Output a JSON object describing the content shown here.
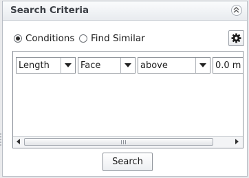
{
  "panel": {
    "title": "Search Criteria",
    "collapse_icon": "double-chevron-up-icon"
  },
  "mode": {
    "options": [
      {
        "label": "Conditions",
        "selected": true
      },
      {
        "label": "Find Similar",
        "selected": false
      }
    ],
    "settings_icon": "gear-icon"
  },
  "criteria": {
    "attribute": "Length",
    "entity": "Face",
    "comparison": "above",
    "value": "0.0 m"
  },
  "actions": {
    "search_label": "Search"
  }
}
